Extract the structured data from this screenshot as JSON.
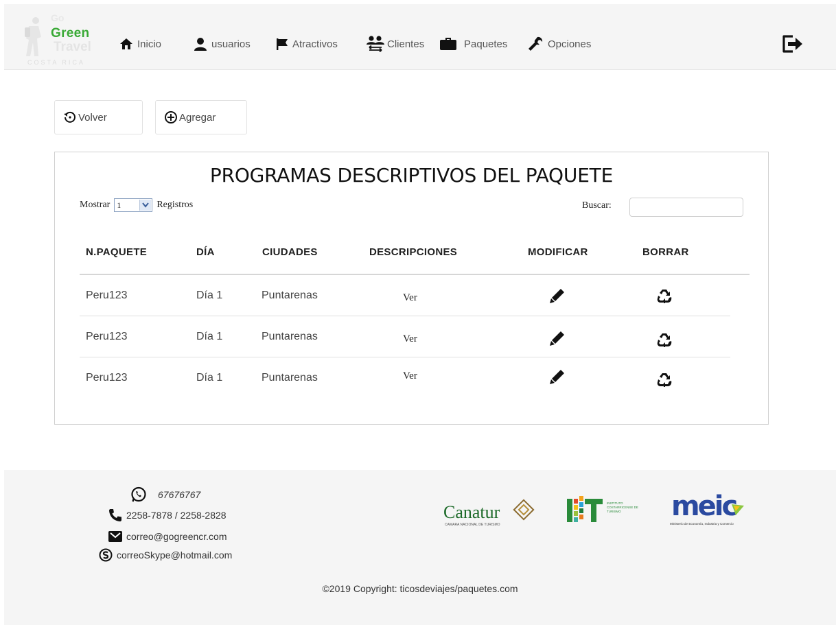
{
  "brand": {
    "go": "Go",
    "green": "Green",
    "travel": "Travel",
    "costa": "COSTA RICA"
  },
  "nav": {
    "items": [
      {
        "label": "Inicio",
        "icon": "home-icon"
      },
      {
        "label": "usuarios",
        "icon": "user-icon"
      },
      {
        "label": "Atractivos",
        "icon": "flag-icon"
      },
      {
        "label": "Clientes",
        "icon": "users-icon"
      },
      {
        "label": "Paquetes",
        "icon": "briefcase-icon"
      },
      {
        "label": "Opciones",
        "icon": "wrench-icon"
      }
    ],
    "logout_icon": "sign-out-icon"
  },
  "toolbar": {
    "back_label": "Volver",
    "add_label": "Agregar"
  },
  "panel": {
    "title": "PROGRAMAS DESCRIPTIVOS DEL PAQUETE",
    "length_prefix": "Mostrar",
    "length_value": "1",
    "length_suffix": "Registros",
    "search_label": "Buscar:",
    "search_value": ""
  },
  "table": {
    "headers": [
      "N.PAQUETE",
      "DÍA",
      "CIUDADES",
      "DESCRIPCIONES",
      "MODIFICAR",
      "BORRAR"
    ],
    "rows": [
      {
        "paquete": "Peru123",
        "dia": "Día 1",
        "ciudad": "Puntarenas",
        "descripcion": "Ver"
      },
      {
        "paquete": "Peru123",
        "dia": "Día 1",
        "ciudad": "Puntarenas",
        "descripcion": "Ver"
      },
      {
        "paquete": "Peru123",
        "dia": "Día 1",
        "ciudad": "Puntarenas",
        "descripcion": "Ver"
      }
    ]
  },
  "footer": {
    "whatsapp": "67676767",
    "phone": "2258-7878 / 2258-2828",
    "email": "correo@gogreencr.com",
    "skype": "correoSkype@hotmail.com",
    "copyright": "©2019 Copyright: ticosdeviajes/paquetes.com",
    "logos": {
      "canatur": "Canatur",
      "canatur_sub": "CAMARA NACIONAL DE TURISMO",
      "ict": "ICT",
      "ict_sub1": "INSTITUTO",
      "ict_sub2": "COSTARRICENSE DE",
      "ict_sub3": "TURISMO",
      "meic": "meic",
      "meic_sub": "Ministerio de Economía, Industria y Comercio"
    }
  },
  "colors": {
    "brand_green": "#39a935",
    "nav_bg": "#f5f5f5",
    "footer_bg": "#f5f5f5",
    "meic_blue": "#2b4aa0"
  }
}
